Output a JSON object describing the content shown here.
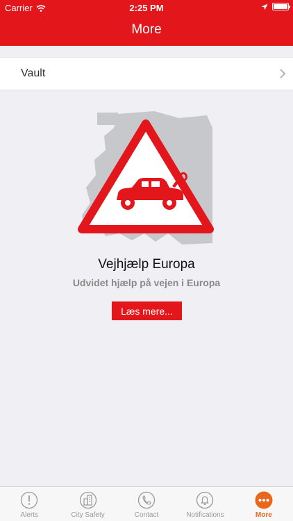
{
  "status_bar": {
    "carrier": "Carrier",
    "time": "2:25 PM"
  },
  "header": {
    "title": "More"
  },
  "vault": {
    "label": "Vault",
    "chevron_icon": "chevron-right-icon"
  },
  "promo": {
    "image_icon": "roadside-assistance-europe-icon",
    "title": "Vejhjælp Europa",
    "subtitle": "Udvidet hjælp på vejen i Europa",
    "button_label": "Læs mere..."
  },
  "tabs": [
    {
      "label": "Alerts",
      "icon": "alert-icon",
      "active": false
    },
    {
      "label": "City Safety",
      "icon": "city-icon",
      "active": false
    },
    {
      "label": "Contact",
      "icon": "phone-icon",
      "active": false
    },
    {
      "label": "Notifications",
      "icon": "bell-icon",
      "active": false
    },
    {
      "label": "More",
      "icon": "more-icon",
      "active": true
    }
  ],
  "colors": {
    "header_red": "#e3161b",
    "background": "#efeff4",
    "active_tab": "#e8671d",
    "inactive_tab": "#9a9a9a"
  }
}
